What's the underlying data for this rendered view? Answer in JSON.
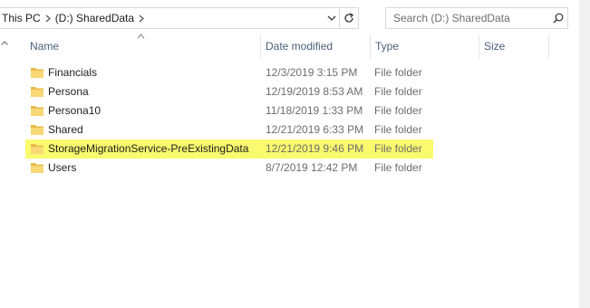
{
  "address": {
    "crumbs": [
      "This PC",
      "(D:) SharedData"
    ]
  },
  "search": {
    "placeholder": "Search (D:) SharedData"
  },
  "columns": {
    "name": "Name",
    "date": "Date modified",
    "type": "Type",
    "size": "Size"
  },
  "files": [
    {
      "name": "Financials",
      "date": "12/3/2019 3:15 PM",
      "type": "File folder",
      "highlighted": false
    },
    {
      "name": "Persona",
      "date": "12/19/2019 8:53 AM",
      "type": "File folder",
      "highlighted": false
    },
    {
      "name": "Persona10",
      "date": "11/18/2019 1:33 PM",
      "type": "File folder",
      "highlighted": false
    },
    {
      "name": "Shared",
      "date": "12/21/2019 6:33 PM",
      "type": "File folder",
      "highlighted": false
    },
    {
      "name": "StorageMigrationService-PreExistingData",
      "date": "12/21/2019 9:46 PM",
      "type": "File folder",
      "highlighted": true
    },
    {
      "name": "Users",
      "date": "8/7/2019 12:42 PM",
      "type": "File folder",
      "highlighted": false
    }
  ],
  "colors": {
    "highlight": "#fafa6e",
    "folder": "#f8d775",
    "header_text": "#4c607a"
  },
  "icons": {
    "folder": "folder-icon",
    "search": "search-icon",
    "refresh": "refresh-icon",
    "dropdown": "chevron-down-icon",
    "separator": "chevron-right-icon",
    "sort": "sort-ascending-icon"
  }
}
